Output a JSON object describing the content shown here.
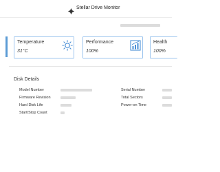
{
  "window": {
    "title": "Stellar Drive Monitor",
    "logo_icon": "stellar-logo-icon"
  },
  "cards": [
    {
      "label": "Temperature",
      "value": "31°C",
      "icon": "sun-icon"
    },
    {
      "label": "Performance",
      "value": "100%",
      "icon": "performance-chart-icon"
    },
    {
      "label": "Health",
      "value": "100%",
      "icon": ""
    }
  ],
  "disk_details": {
    "title": "Disk Details",
    "left_fields": [
      {
        "label": "Model Number",
        "value": ""
      },
      {
        "label": "Firmware Revision",
        "value": ""
      },
      {
        "label": "Hard Disk Life",
        "value": ""
      },
      {
        "label": "Start/Stop Count",
        "value": ""
      }
    ],
    "right_fields": [
      {
        "label": "Serial Number",
        "value": ""
      },
      {
        "label": "Total Sectors",
        "value": ""
      },
      {
        "label": "Power-on Time",
        "value": ""
      }
    ]
  },
  "colors": {
    "accent": "#5b9bd5",
    "card_border": "#9cc4ee",
    "icon_blue": "#4a8fd6"
  }
}
